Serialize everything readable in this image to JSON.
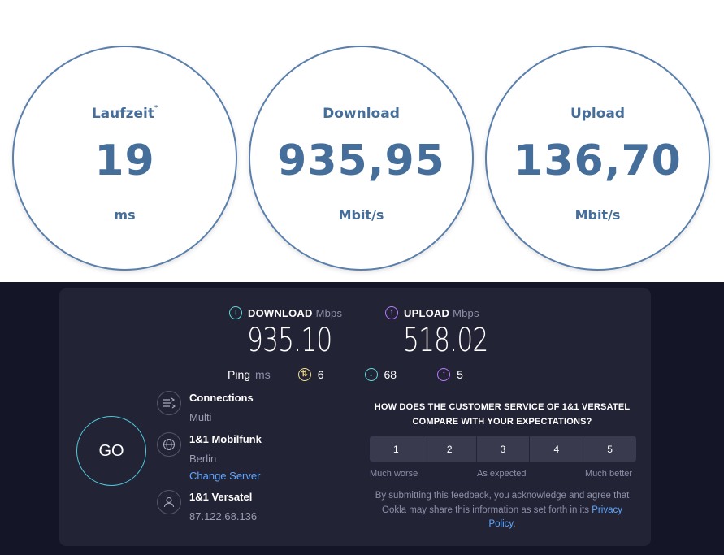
{
  "circles": [
    {
      "label": "Laufzeit",
      "marker": "*",
      "value": "19",
      "unit": "ms"
    },
    {
      "label": "Download",
      "value": "935,95",
      "unit": "Mbit/s"
    },
    {
      "label": "Upload",
      "value": "136,70",
      "unit": "Mbit/s"
    }
  ],
  "speedtest": {
    "download": {
      "label": "DOWNLOAD",
      "unit": "Mbps",
      "value": "935.10",
      "icon": "download-arrow-icon"
    },
    "upload": {
      "label": "UPLOAD",
      "unit": "Mbps",
      "value": "518.02",
      "icon": "upload-arrow-icon"
    },
    "ping": {
      "label": "Ping",
      "unit": "ms",
      "idle": "6",
      "download": "68",
      "upload": "5"
    },
    "go_label": "GO",
    "connections": {
      "title": "Connections",
      "value": "Multi"
    },
    "server": {
      "title": "1&1 Mobilfunk",
      "location": "Berlin",
      "change_label": "Change Server"
    },
    "provider": {
      "title": "1&1 Versatel",
      "ip": "87.122.68.136"
    },
    "survey": {
      "question": "HOW DOES THE CUSTOMER SERVICE OF 1&1 VERSATEL COMPARE WITH YOUR EXPECTATIONS?",
      "options": [
        "1",
        "2",
        "3",
        "4",
        "5"
      ],
      "scale_low": "Much worse",
      "scale_mid": "As expected",
      "scale_high": "Much better",
      "disclaimer": "By submitting this feedback, you acknowledge and agree that Ookla may share this information as set forth in its",
      "privacy_label": "Privacy Policy",
      "privacy_suffix": "."
    }
  },
  "colors": {
    "circle_text": "#466e9a",
    "dark_bg": "#141526",
    "panel_bg": "#232336",
    "download_accent": "#5fdbdc",
    "upload_accent": "#bb78ff",
    "ping_accent": "#f0e08a",
    "link": "#5fa8ff"
  }
}
